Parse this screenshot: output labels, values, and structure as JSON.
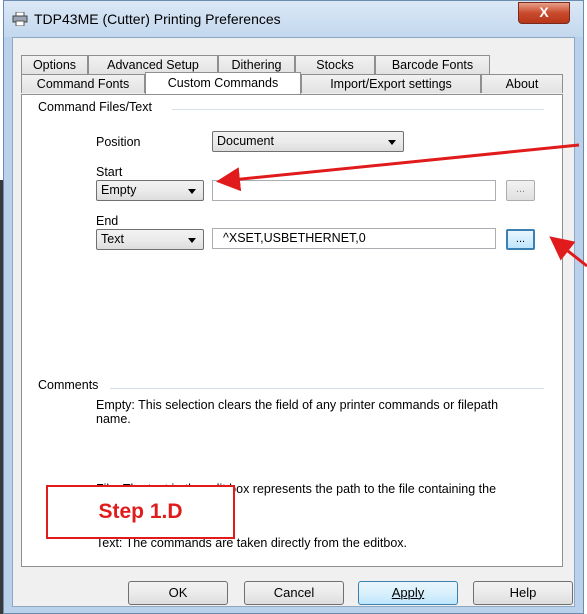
{
  "window": {
    "title": "TDP43ME (Cutter) Printing Preferences",
    "close_label": "X"
  },
  "tabs_row1": [
    {
      "label": "Options"
    },
    {
      "label": "Advanced Setup"
    },
    {
      "label": "Dithering"
    },
    {
      "label": "Stocks"
    },
    {
      "label": "Barcode Fonts"
    }
  ],
  "tabs_row2": [
    {
      "label": "Command Fonts"
    },
    {
      "label": "Custom Commands",
      "active": true
    },
    {
      "label": "Import/Export settings"
    },
    {
      "label": "About"
    }
  ],
  "command_group": {
    "title": "Command Files/Text",
    "position_label": "Position",
    "position_value": "Document",
    "start_label": "Start",
    "start_value": "Empty",
    "start_text": "",
    "end_label": "End",
    "end_value": "Text",
    "end_text": "^XSET,USBETHERNET,0",
    "browse_label": "..."
  },
  "comments": {
    "title": "Comments",
    "empty_text": "Empty: This selection clears the field of any printer commands or filepath name.",
    "file_text": "File: The text in the edit box represents the path to the file containing the printer commands.",
    "text_text": "Text: The commands are taken directly from the editbox."
  },
  "callout": {
    "label": "Step 1.D"
  },
  "buttons": {
    "ok": "OK",
    "cancel": "Cancel",
    "apply": "Apply",
    "help": "Help"
  },
  "colors": {
    "annotation": "#e11b1b",
    "titlebar": "#c3d8ee",
    "focus": "#3c7fb1"
  }
}
